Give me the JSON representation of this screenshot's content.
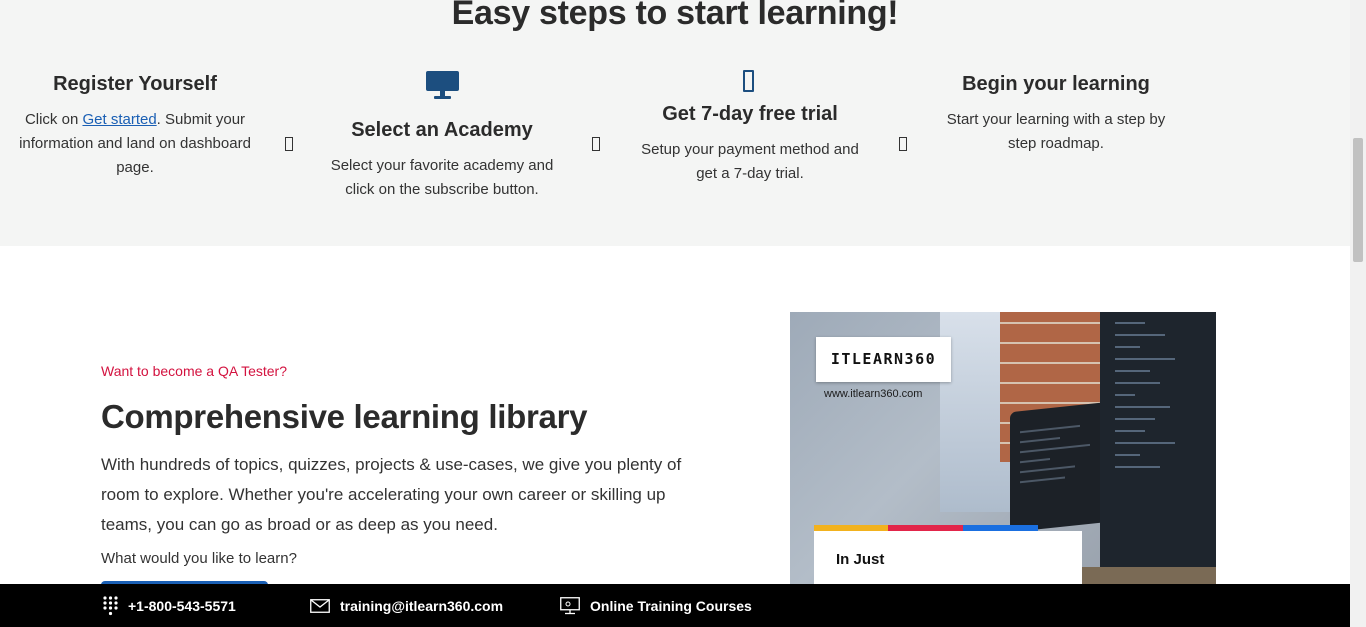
{
  "steps": {
    "heading": "Easy steps to start learning!",
    "items": [
      {
        "title": "Register Yourself",
        "desc_prefix": "Click on ",
        "desc_link": "Get started",
        "desc_suffix": ". Submit your information and land on dashboard page."
      },
      {
        "title": "Select an Academy",
        "desc": "Select your favorite academy and click on the subscribe button.",
        "icon": "monitor-icon"
      },
      {
        "title": "Get 7-day free trial",
        "desc": "Setup your payment method and get a 7-day trial.",
        "icon": "card-icon"
      },
      {
        "title": "Begin your learning",
        "desc": "Start your learning with a step by step roadmap."
      }
    ]
  },
  "library": {
    "eyebrow": "Want to become a QA Tester?",
    "heading": "Comprehensive learning library",
    "body": "With hundreds of topics, quizzes, projects & use-cases, we give you plenty of room to explore. Whether you're accelerating your own career or skilling up teams, you can go as broad or as deep as you need.",
    "question": "What would you like to learn?"
  },
  "promo": {
    "logo": "ITLEARN360",
    "url": "www.itlearn360.com",
    "card_text": "In Just"
  },
  "contact": {
    "phone": "+1-800-543-5571",
    "email": "training@itlearn360.com",
    "courses": "Online Training Courses"
  },
  "colors": {
    "accent_red": "#d3123f",
    "link_blue": "#1a5fb4",
    "icon_navy": "#1c4e7f",
    "steps_bg": "#f4f5f4",
    "contact_bar_bg": "#000000"
  }
}
